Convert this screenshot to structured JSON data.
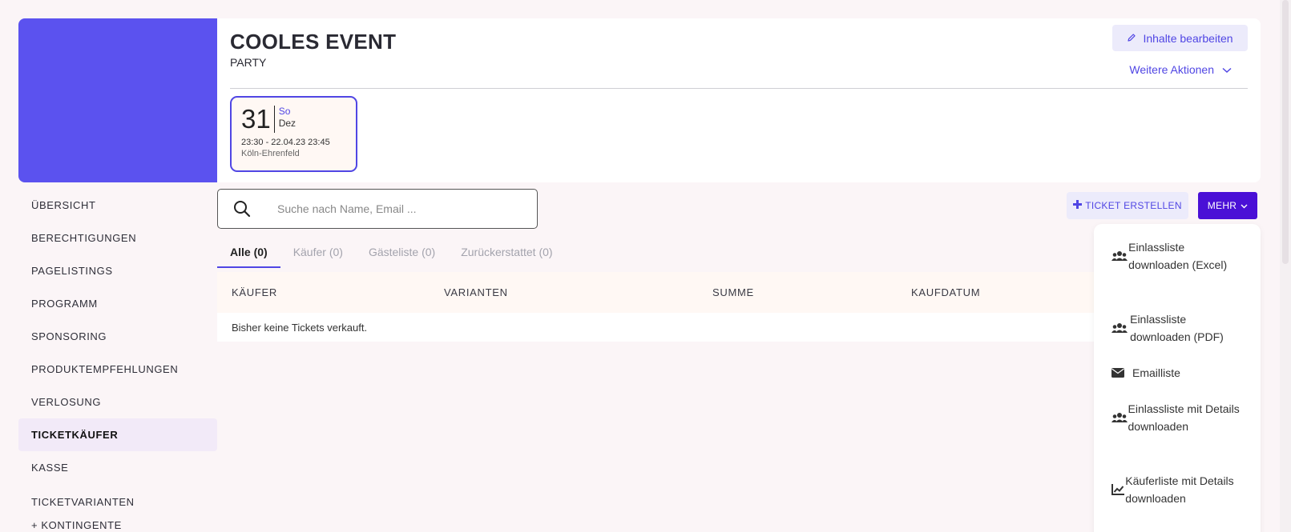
{
  "event": {
    "title": "COOLES EVENT",
    "category": "PARTY",
    "date": {
      "day": "31",
      "weekday": "So",
      "month": "Dez",
      "range": "23:30 - 22.04.23 23:45",
      "venue": "Köln-Ehrenfeld"
    }
  },
  "header": {
    "edit_label": "Inhalte bearbeiten",
    "more_actions_label": "Weitere Aktionen"
  },
  "sidebar": {
    "items": [
      {
        "label": "ÜBERSICHT"
      },
      {
        "label": "BERECHTIGUNGEN"
      },
      {
        "label": "PAGELISTINGS"
      },
      {
        "label": "PROGRAMM"
      },
      {
        "label": "SPONSORING"
      },
      {
        "label": "PRODUKTEMPFEHLUNGEN"
      },
      {
        "label": "VERLOSUNG"
      },
      {
        "label": "TICKETKÄUFER"
      },
      {
        "label": "KASSE"
      },
      {
        "label": "TICKETVARIANTEN + KONTINGENTE"
      }
    ],
    "active_index": 7
  },
  "search": {
    "placeholder": "Suche nach Name, Email ..."
  },
  "toolbar": {
    "create_ticket_label": "TICKET ERSTELLEN",
    "mehr_label": "MEHR"
  },
  "tabs": [
    {
      "label": "Alle (0)"
    },
    {
      "label": "Käufer (0)"
    },
    {
      "label": "Gästeliste (0)"
    },
    {
      "label": "Zurückerstattet (0)"
    }
  ],
  "table": {
    "columns": [
      "KÄUFER",
      "VARIANTEN",
      "SUMME",
      "KAUFDATUM"
    ],
    "empty_text": "Bisher keine Tickets verkauft."
  },
  "dropdown": {
    "items": [
      {
        "label": "Einlassliste downloaden (Excel)",
        "icon": "users-icon"
      },
      {
        "label": "Einlassliste downloaden (PDF)",
        "icon": "users-icon"
      },
      {
        "label": "Emailliste",
        "icon": "envelope-icon"
      },
      {
        "label": "Einlassliste mit Details downloaden",
        "icon": "users-icon"
      },
      {
        "label": "Käuferliste mit Details downloaden",
        "icon": "chart-line-icon"
      }
    ]
  },
  "colors": {
    "accent": "#5046e4",
    "cover": "#5b52ef",
    "primary_button": "#4a10d6",
    "background": "#fbf5f7"
  }
}
